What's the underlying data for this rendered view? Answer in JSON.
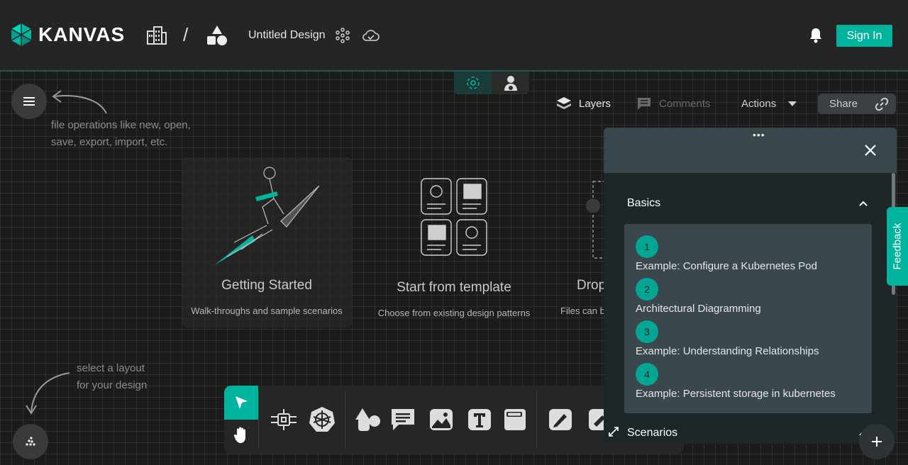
{
  "header": {
    "logo_text": "KANVAS",
    "separator": "/",
    "design_title": "Untitled Design",
    "sign_in": "Sign In"
  },
  "hints": {
    "file_ops": "file operations like new, open, save, export, import, etc.",
    "layout_line1": "select a layout",
    "layout_line2": "for your design"
  },
  "tabs": {
    "layers": "Layers",
    "comments": "Comments",
    "actions": "Actions",
    "share": "Share"
  },
  "cards": [
    {
      "title": "Getting Started",
      "subtitle": "Walk-throughs and sample scenarios"
    },
    {
      "title": "Start from template",
      "subtitle": "Choose from existing design patterns"
    },
    {
      "title": "Drop",
      "subtitle": "Files can b"
    }
  ],
  "panel": {
    "dots": "•••",
    "basics_title": "Basics",
    "scenarios_title": "Scenarios",
    "basics": [
      {
        "num": "1",
        "label": "Example: Configure a Kubernetes Pod"
      },
      {
        "num": "2",
        "label": "Architectural Diagramming"
      },
      {
        "num": "3",
        "label": "Example: Understanding Relationships"
      },
      {
        "num": "4",
        "label": "Example: Persistent storage in kubernetes"
      }
    ]
  },
  "feedback": "Feedback",
  "colors": {
    "accent": "#00b39f",
    "background": "#1b1b1b",
    "panel": "#1d2629"
  }
}
